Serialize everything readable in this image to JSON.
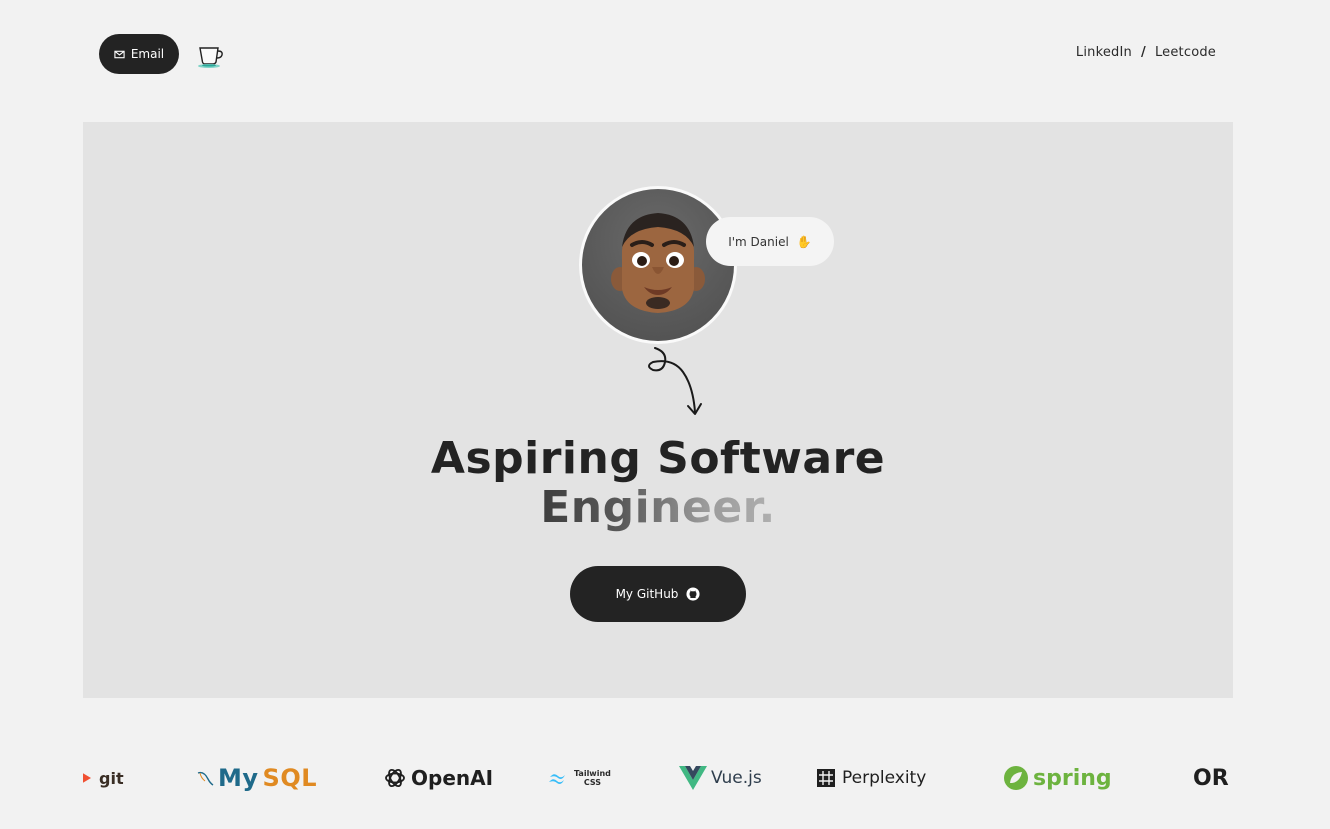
{
  "header": {
    "email_label": "Email",
    "links": [
      "LinkedIn",
      "Leetcode"
    ],
    "separator": "/"
  },
  "hero": {
    "greeting": "I'm Daniel",
    "headline_line1": "Aspiring Software",
    "headline_line2": "Engineer.",
    "github_label": "My GitHub"
  },
  "logos": {
    "git": "git",
    "mysql_my": "My",
    "mysql_sql": "SQL",
    "openai": "OpenAI",
    "tailwind_line1": "Tailwind",
    "tailwind_line2": "CSS",
    "vue": "Vue.js",
    "perplexity": "Perplexity",
    "spring": "spring",
    "partial": "OR"
  },
  "colors": {
    "background": "#f2f2f2",
    "hero_bg": "#e3e3e3",
    "button_dark": "#232323",
    "spring_green": "#6db33f",
    "mysql_blue": "#1f6a8a",
    "mysql_orange": "#e08a22",
    "vue_green": "#41b883",
    "git_red": "#f05032"
  },
  "icons": [
    "mail-icon",
    "coffee-cup-icon",
    "waving-hand-icon",
    "curly-arrow-icon",
    "github-icon"
  ]
}
